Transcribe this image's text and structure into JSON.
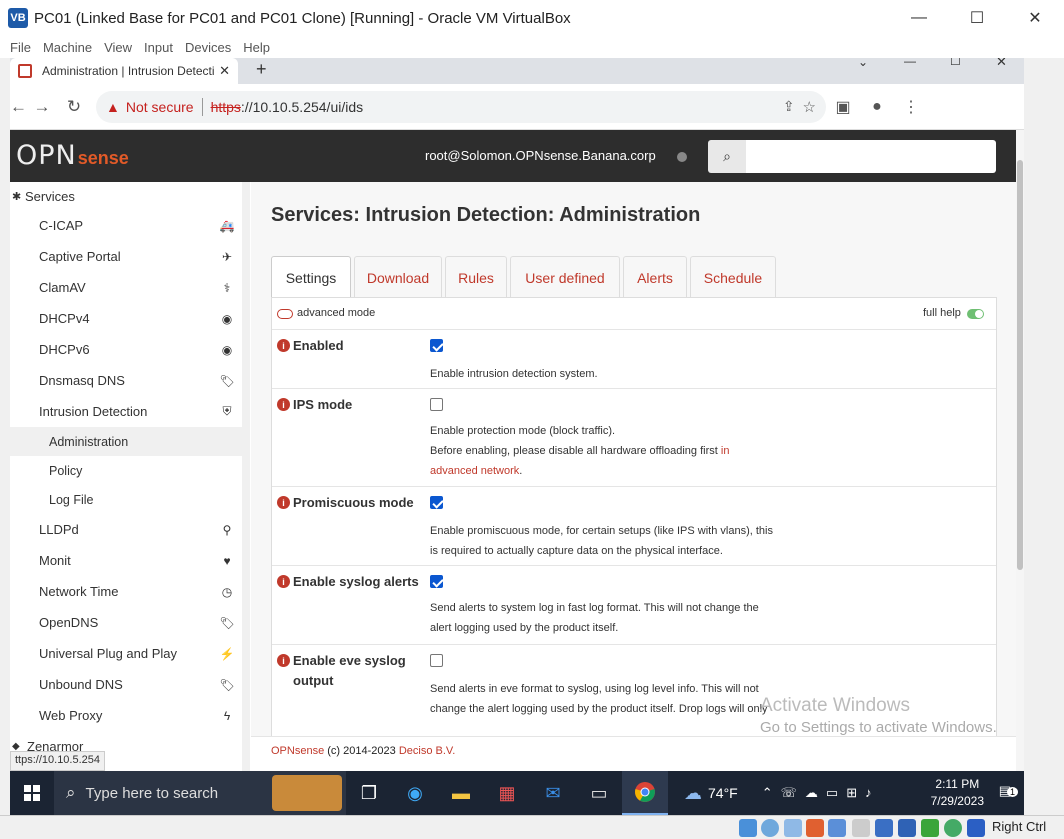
{
  "window": {
    "title": "PC01 (Linked Base for PC01 and PC01 Clone) [Running] - Oracle VM VirtualBox"
  },
  "vb_menu": [
    "File",
    "Machine",
    "View",
    "Input",
    "Devices",
    "Help"
  ],
  "browser": {
    "tab_title": "Administration | Intrusion Detecti",
    "not_secure": "Not secure",
    "url_scheme": "https",
    "url_rest": "://10.10.5.254/ui/ids",
    "status_url": "ttps://10.10.5.254"
  },
  "header": {
    "logo_a": "OPN",
    "logo_b": "sense",
    "user": "root@Solomon.OPNsense.Banana.corp",
    "search_placeholder": ""
  },
  "sidebar": {
    "section": "Services",
    "items": [
      {
        "label": "C-ICAP",
        "icon": "ambulance-icon",
        "glyph": "🚑"
      },
      {
        "label": "Captive Portal",
        "icon": "paper-plane-icon",
        "glyph": "✈"
      },
      {
        "label": "ClamAV",
        "icon": "stethoscope-icon",
        "glyph": "⚕"
      },
      {
        "label": "DHCPv4",
        "icon": "bullseye-icon",
        "glyph": "◉"
      },
      {
        "label": "DHCPv6",
        "icon": "bullseye-icon",
        "glyph": "◉"
      },
      {
        "label": "Dnsmasq DNS",
        "icon": "tags-icon",
        "glyph": "🏷"
      },
      {
        "label": "Intrusion Detection",
        "icon": "shield-icon",
        "glyph": "⛨"
      },
      {
        "label": "Administration",
        "sub": true,
        "active": true
      },
      {
        "label": "Policy",
        "sub": true
      },
      {
        "label": "Log File",
        "sub": true
      },
      {
        "label": "LLDPd",
        "icon": "binoculars-icon",
        "glyph": "⚲"
      },
      {
        "label": "Monit",
        "icon": "heartbeat-icon",
        "glyph": "♥"
      },
      {
        "label": "Network Time",
        "icon": "clock-icon",
        "glyph": "◷"
      },
      {
        "label": "OpenDNS",
        "icon": "tags-icon",
        "glyph": "🏷"
      },
      {
        "label": "Universal Plug and Play",
        "icon": "plug-icon",
        "glyph": "⚡"
      },
      {
        "label": "Unbound DNS",
        "icon": "tags-icon",
        "glyph": "🏷"
      },
      {
        "label": "Web Proxy",
        "icon": "bolt-icon",
        "glyph": "ϟ"
      },
      {
        "label": "Zenarmor",
        "icon": "",
        "glyph": ""
      }
    ]
  },
  "main": {
    "title": "Services: Intrusion Detection: Administration",
    "tabs": [
      "Settings",
      "Download",
      "Rules",
      "User defined",
      "Alerts",
      "Schedule"
    ],
    "advanced_mode": "advanced mode",
    "full_help": "full help",
    "settings": [
      {
        "label": "Enabled",
        "checked": true,
        "help": "Enable intrusion detection system."
      },
      {
        "label": "IPS mode",
        "checked": false,
        "help1": "Enable protection mode (block traffic).",
        "help2": "Before enabling, please disable all hardware offloading first ",
        "help_link1": "in",
        "help_link2": "advanced network",
        "help3": "."
      },
      {
        "label": "Promiscuous mode",
        "checked": true,
        "help1": "Enable promiscuous mode, for certain setups (like IPS with vlans), this",
        "help2": "is required to actually capture data on the physical interface."
      },
      {
        "label": "Enable syslog alerts",
        "checked": true,
        "help1": "Send alerts to system log in fast log format. This will not change the",
        "help2": "alert logging used by the product itself."
      },
      {
        "label": "Enable eve syslog output",
        "checked": false,
        "help1": "Send alerts in eve format to syslog, using log level info. This will not",
        "help2": "change the alert logging used by the product itself. Drop logs will only"
      }
    ],
    "footer_brand": "OPNsense",
    "footer_mid": " (c) 2014-2023 ",
    "footer_corp": "Deciso B.V."
  },
  "watermark": {
    "line1": "Activate Windows",
    "line2": "Go to Settings to activate Windows."
  },
  "taskbar": {
    "search": "Type here to search",
    "weather": "74°F",
    "time": "2:11 PM",
    "date": "7/29/2023",
    "notif": "1"
  },
  "vbox_status": {
    "host_key": "Right Ctrl"
  }
}
